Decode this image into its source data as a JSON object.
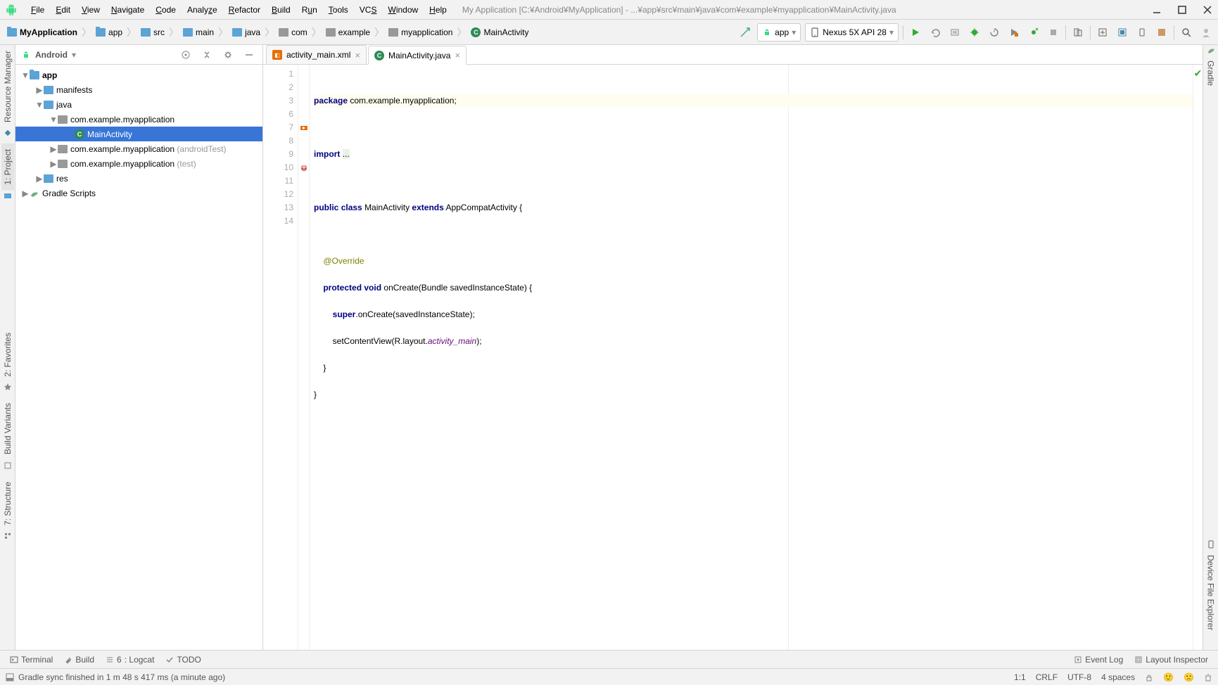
{
  "title": "My Application [C:¥Android¥MyApplication] - ...¥app¥src¥main¥java¥com¥example¥myapplication¥MainActivity.java",
  "menu": [
    "File",
    "Edit",
    "View",
    "Navigate",
    "Code",
    "Analyze",
    "Refactor",
    "Build",
    "Run",
    "Tools",
    "VCS",
    "Window",
    "Help"
  ],
  "breadcrumb": [
    "MyApplication",
    "app",
    "src",
    "main",
    "java",
    "com",
    "example",
    "myapplication",
    "MainActivity"
  ],
  "run_config": "app",
  "device": "Nexus 5X API 28",
  "panel_title": "Android",
  "tree": {
    "app": "app",
    "manifests": "manifests",
    "java": "java",
    "pkg1": "com.example.myapplication",
    "main_activity": "MainActivity",
    "pkg2": "com.example.myapplication",
    "pkg2_suffix": "(androidTest)",
    "pkg3": "com.example.myapplication",
    "pkg3_suffix": "(test)",
    "res": "res",
    "gradle": "Gradle Scripts"
  },
  "tabs": {
    "t1": "activity_main.xml",
    "t2": "MainActivity.java"
  },
  "code_lines": {
    "l1": {
      "n": "1"
    },
    "l2": {
      "n": "2"
    },
    "l3": {
      "n": "3"
    },
    "l6": {
      "n": "6"
    },
    "l7": {
      "n": "7"
    },
    "l8": {
      "n": "8"
    },
    "l9": {
      "n": "9"
    },
    "l10": {
      "n": "10"
    },
    "l11": {
      "n": "11"
    },
    "l12": {
      "n": "12"
    },
    "l13": {
      "n": "13"
    },
    "l14": {
      "n": "14"
    }
  },
  "code_tokens": {
    "package": "package",
    "pkg_name": "com.example.myapplication;",
    "import": "import",
    "dots": "...",
    "public": "public",
    "class": "class",
    "MainActivity": "MainActivity",
    "extends": "extends",
    "AppCompat": "AppCompatActivity {",
    "override": "@Override",
    "protected": "protected",
    "void": "void",
    "onCreate": "onCreate(Bundle savedInstanceState) {",
    "super": "super",
    "super_call": ".onCreate(savedInstanceState);",
    "setContent": "setContentView(R.layout.",
    "activity_main": "activity_main",
    "close_paren": ");",
    "brace1": "    }",
    "brace2": "}"
  },
  "left_tabs": {
    "resource": "Resource Manager",
    "project": "1: Project",
    "favorites": "2: Favorites",
    "build_variants": "Build Variants",
    "structure": "7: Structure"
  },
  "right_tabs": {
    "gradle": "Gradle",
    "device_explorer": "Device File Explorer"
  },
  "bottom": {
    "terminal": "Terminal",
    "build": "Build",
    "logcat": "6: Logcat",
    "todo": "TODO",
    "event_log": "Event Log",
    "layout_inspector": "Layout Inspector"
  },
  "status": {
    "msg": "Gradle sync finished in 1 m 48 s 417 ms (a minute ago)",
    "pos": "1:1",
    "eol": "CRLF",
    "enc": "UTF-8",
    "indent": "4 spaces"
  }
}
